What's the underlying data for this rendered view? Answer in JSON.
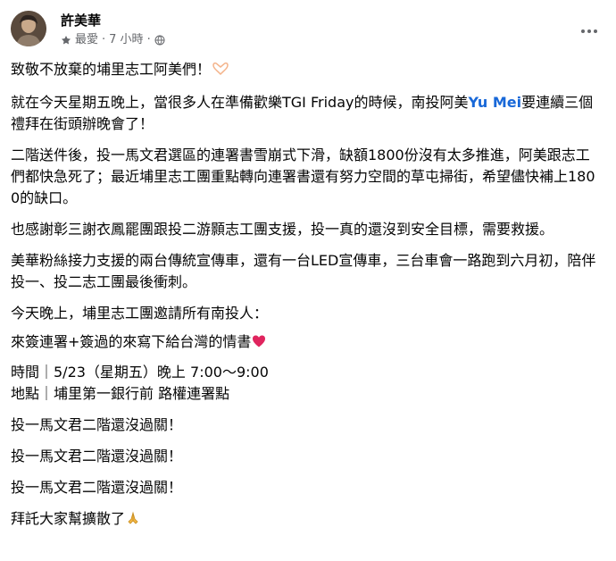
{
  "post": {
    "author": "許美華",
    "audience": "最愛",
    "time": "7 小時",
    "dot": "·",
    "paragraphs": {
      "p1": "致敬不放棄的埔里志工阿美們！",
      "p2_before": "就在今天星期五晚上，當很多人在準備歡樂TGI Friday的時候，南投阿美",
      "p2_mention": "Yu Mei",
      "p2_after": "要連續三個禮拜在街頭辦晚會了！",
      "p3": "二階送件後，投一馬文君選區的連署書雪崩式下滑，缺額1800份沒有太多推進，阿美跟志工們都快急死了；最近埔里志工團重點轉向連署書還有努力空間的草屯掃街，希望儘快補上1800的缺口。",
      "p4": "也感謝彰三謝衣鳳罷團跟投二游顥志工團支援，投一真的還沒到安全目標，需要救援。",
      "p5": "美華粉絲接力支援的兩台傳統宣傳車，還有一台LED宣傳車，三台車會一路跑到六月初，陪伴投一、投二志工團最後衝刺。",
      "p6": "今天晚上，埔里志工團邀請所有南投人：",
      "p7": "來簽連署+簽過的來寫下給台灣的情書",
      "p8_time": "時間｜5/23（星期五）晚上 7:00～9:00",
      "p8_place": "地點｜埔里第一銀行前 路權連署點",
      "p9": "投一馬文君二階還沒過關！",
      "p10": "投一馬文君二階還沒過關！",
      "p11": "投一馬文君二階還沒過關！",
      "p12": "拜託大家幫擴散了"
    },
    "icons": {
      "audience": "star-icon",
      "privacy": "globe-icon",
      "menu": "more-icon",
      "hands": "heart-hands-emoji",
      "heart": "red-heart-emoji",
      "pray": "folded-hands-emoji"
    },
    "colors": {
      "text": "#050505",
      "meta": "#65676b",
      "mention": "#1868d8",
      "heart": "#e0245e"
    }
  }
}
